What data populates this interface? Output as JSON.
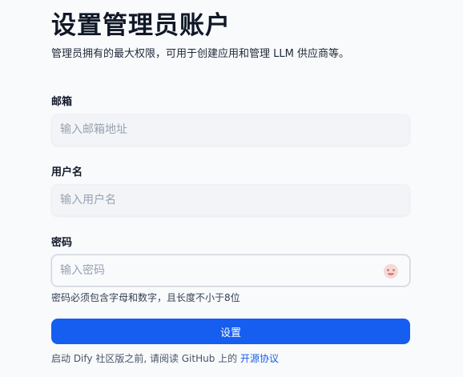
{
  "header": {
    "title": "设置管理员账户",
    "subtitle": "管理员拥有的最大权限，可用于创建应用和管理 LLM 供应商等。"
  },
  "form": {
    "email": {
      "label": "邮箱",
      "placeholder": "输入邮箱地址",
      "value": ""
    },
    "username": {
      "label": "用户名",
      "placeholder": "输入用户名",
      "value": ""
    },
    "password": {
      "label": "密码",
      "placeholder": "输入密码",
      "value": "",
      "hint": "密码必须包含字母和数字，且长度不小于8位",
      "toggle_icon": "eye-toggle-icon"
    },
    "submit_label": "设置"
  },
  "footer": {
    "text": "启动 Dify 社区版之前, 请阅读 GitHub 上的 ",
    "link_label": "开源协议"
  },
  "colors": {
    "accent": "#155eef",
    "background": "#f9fafb",
    "input_bg": "#f2f4f7",
    "placeholder": "#98a2b3"
  }
}
